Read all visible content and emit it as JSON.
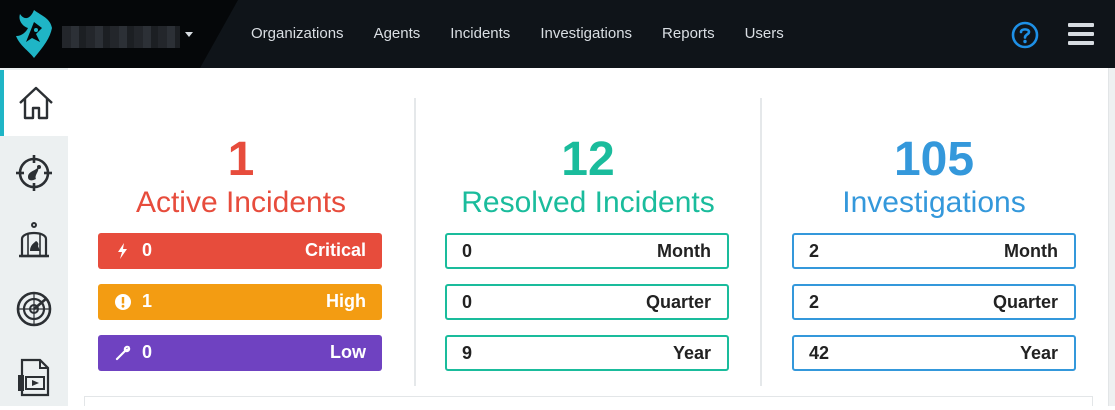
{
  "nav": {
    "items": [
      "Organizations",
      "Agents",
      "Incidents",
      "Investigations",
      "Reports",
      "Users"
    ]
  },
  "colors": {
    "topbar": "#0f1419",
    "accent": "#1fb5c6",
    "red": "#e74c3c",
    "orange": "#f39c12",
    "purple": "#6f42c1",
    "teal": "#1abc9c",
    "blue": "#3498db"
  },
  "sidebar": {
    "icons": [
      "home-icon",
      "target-icon",
      "birdcage-icon",
      "radar-icon",
      "video-file-icon"
    ]
  },
  "active": {
    "count": "1",
    "label": "Active Incidents",
    "rows": [
      {
        "icon": "bolt-icon",
        "value": "0",
        "label": "Critical"
      },
      {
        "icon": "exclamation-circle-icon",
        "value": "1",
        "label": "High"
      },
      {
        "icon": "wrench-icon",
        "value": "0",
        "label": "Low"
      }
    ]
  },
  "resolved": {
    "count": "12",
    "label": "Resolved Incidents",
    "rows": [
      {
        "value": "0",
        "label": "Month"
      },
      {
        "value": "0",
        "label": "Quarter"
      },
      {
        "value": "9",
        "label": "Year"
      }
    ]
  },
  "investigations": {
    "count": "105",
    "label": "Investigations",
    "rows": [
      {
        "value": "2",
        "label": "Month"
      },
      {
        "value": "2",
        "label": "Quarter"
      },
      {
        "value": "42",
        "label": "Year"
      }
    ]
  }
}
